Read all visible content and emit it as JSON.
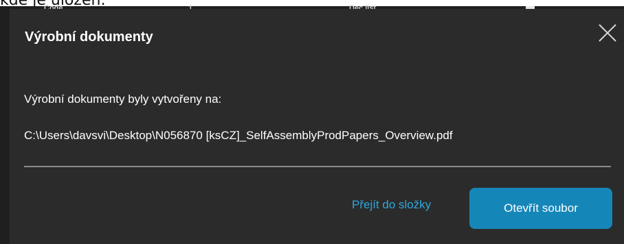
{
  "background": {
    "partial_text": "kde je uložen:",
    "column_fragments": [
      "Code",
      "1",
      "Dec list"
    ]
  },
  "dialog": {
    "title": "Výrobní dokumenty",
    "message": "Výrobní dokumenty byly vytvořeny na:",
    "file_path": "C:\\Users\\davsvi\\Desktop\\N056870 [ksCZ]_SelfAssemblyProdPapers_Overview.pdf",
    "close_icon": "close-icon",
    "buttons": {
      "go_to_folder": "Přejít do složky",
      "open_file": "Otevřít soubor"
    }
  },
  "colors": {
    "dialog_background": "#2b2b2b",
    "link": "#2ea8df",
    "primary_button": "#1586b8",
    "divider": "#8c8c8c"
  }
}
